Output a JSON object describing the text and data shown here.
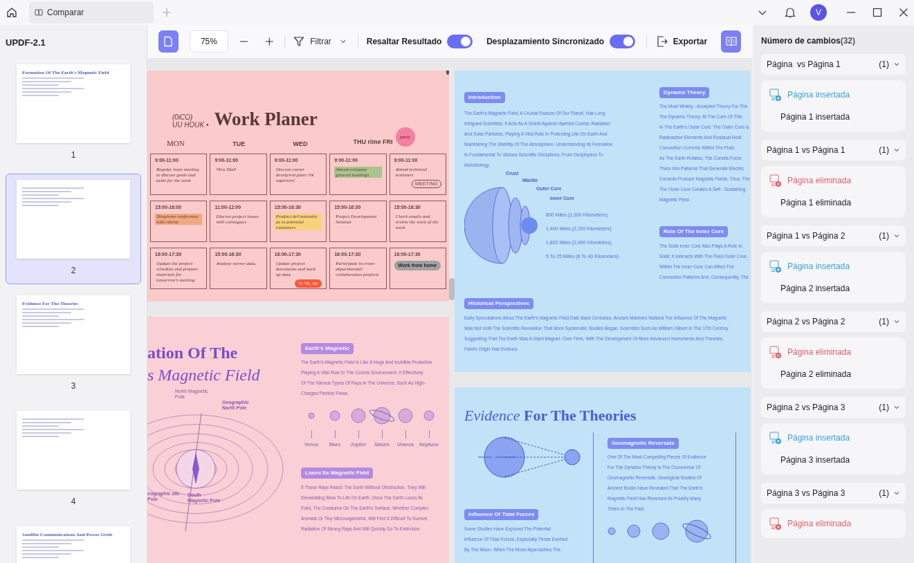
{
  "window": {
    "tab": "Comparar",
    "avatar": "V"
  },
  "sidebar": {
    "title": "UPDF-2.1",
    "thumbnails": [
      {
        "label": "1",
        "selected": false,
        "heading": "Formation Of The Earth's Magnetic Field"
      },
      {
        "label": "2",
        "selected": true
      },
      {
        "label": "3",
        "selected": false,
        "heading": "Evidence For The Theories"
      },
      {
        "label": "4",
        "selected": false
      },
      {
        "selected": false,
        "heading": "Satellite Communications And Power Grids"
      }
    ]
  },
  "toolbar": {
    "zoom": "75%",
    "filter": "Filtrar",
    "toggles": [
      {
        "label": "Resaltar Resultado",
        "on": true
      },
      {
        "label": "Desplazamiento Sincronizado",
        "on": true
      }
    ],
    "export": "Exportar"
  },
  "planner": {
    "scribble": [
      "(0iCO)",
      "UU HOUK •"
    ],
    "title": "Work Planer",
    "days": [
      "MON",
      "TUE",
      "WED",
      "THU rime FRI"
    ],
    "sticker": "party",
    "cells": [
      {
        "time": "9:00-11:00",
        "note": "Regular team meeting to discuss goals and tasks for the week"
      },
      {
        "time": "9:00-11:00",
        "note": "View Mail"
      },
      {
        "time": "9:00-11:00",
        "note": "Discuss career develp'ent plare i'tk superiors'"
      },
      {
        "time": "9:00-11:00",
        "note": "Attend company general meetings",
        "color": "#a9c48f"
      },
      {
        "time": "9:00-11:00",
        "note": "Attend technical seminars",
        "sticker": {
          "kind": "stamp",
          "text": "MEETING"
        }
      },
      {
        "time": "15:00-16:00",
        "note": "Telephone conference with clients",
        "color": "#f2a77e"
      },
      {
        "time": "11:00-12:00",
        "note": "Discuss project issues with colleagues"
      },
      {
        "time": "15:00-16:30",
        "note": "Product del'onstratio as to potential customers",
        "color": "#f7d27a"
      },
      {
        "time": "15:00-16:30",
        "note": "Project Development Seminar"
      },
      {
        "time": "15:00-16:30",
        "note": "Check emails and review the work of the week"
      },
      {
        "time": "16:00-17:30",
        "note": "Update the project schedule and prepare materials for tomorrow's meeting"
      },
      {
        "time": "15:00-16:30",
        "note": "Analyze survey data."
      },
      {
        "time": "16:00-17:30",
        "note": "Update project documents and back up data",
        "sticker": {
          "kind": "blob",
          "text": "'n ^m, ce"
        }
      },
      {
        "time": "16:00-17:30",
        "note": "Participate in cross-departmental/ collaboration projects"
      },
      {
        "time": "16:00-17:30",
        "sticker": {
          "kind": "pill",
          "text": "Work from home"
        }
      }
    ]
  },
  "formation": {
    "title": [
      "ation Of The",
      "s Magnetic Field"
    ],
    "poles": [
      "North Magnetic Pole",
      "Geographic North Pole",
      "eographic uth Pole",
      "South Magnetic Pole"
    ],
    "sections": [
      {
        "heading": "Earth's Magnetic",
        "lines": [
          "The Earth's Magnetic Field Is Like A Huge And Invisible Protective",
          "Playing A Vital Role In The Cosmic Environment. It Effectively",
          "Of The Various Types Of Rays In The Universe, Such As High-",
          "Charged Particle Flows."
        ]
      },
      {
        "heading": "Loses Its Magnetic Field",
        "lines": [
          "If These Rays Reach The Earth Without Obstruction, They Will",
          "Devastating Blow To Life On Earth. Once The Earth Loses Its",
          "Field, The Creatures On The Earth's Surface, Whether Complex",
          "Animals Or Tiny Microorganisms, Will Find It Difficult To Survive",
          "Radiation Of Strong Rays And Will Quickly Go To Extinction."
        ]
      }
    ],
    "planets": [
      "Venus",
      "Mars",
      "Jupiter",
      "Saturn",
      "Uranus",
      "Neptune"
    ]
  },
  "introduction": {
    "intro": {
      "heading": "Introduction",
      "lines": [
        "The Earth's Magnetic Field, A Crucial Feature Of Our Planet, Has Long",
        "Intrigued Scientists. It Acts As A Shield Against Harmful Cosmic Radiation",
        "And Solar Particles, Playing A Vital Role In Protecting Life On Earth And",
        "Maintaining The Stability Of The Atmosphere. Understanding Its Formation",
        "Is Fundamental To Various Scientific Disciplines, From Geophysics To",
        "Astrobiology."
      ]
    },
    "layers": [
      "Crust",
      "Mantle",
      "Outer Core",
      "Inner Core"
    ],
    "depths": [
      "800 Miles (1,300 Kilometers)",
      "1,400 Miles (2,250 Kilometers)",
      "1,800 Miles (2,900 Kilometers)",
      "5 To 25 Miles (8 To 40 Kilometers)"
    ],
    "side": [
      {
        "heading": "Dynamo Theory",
        "lines": [
          "The Most Widely - Accepted Theory For The",
          "The Dynamo Theory. At The Core Of This",
          "In The Earth's Outer Core. The Outer Core Is",
          "Radioactive Elements And Residual Heat",
          "Convection Currents Within The Fluid.",
          "As The Earth Rotates, The Coriolis Force",
          "Them Into Patterns That Generate Electric",
          "Currents Produce Magnetic Fields. Thus, The",
          "The Outer Core Creates A Self - Sustaining",
          "Magnetic Field."
        ]
      },
      {
        "heading": "Role Of The Inner Core",
        "lines": [
          "The Solid Inner Core Also Plays A Role In",
          "Solid, It Interacts With The Fluid Outer Core.",
          "Within The Inner Core Can Affect The",
          "Convective Patterns And, Consequently, The"
        ]
      }
    ],
    "history": {
      "heading": "Historical Perspectives",
      "lines": [
        "Early Speculations About The Earth's Magnetic Field Date Back Centuries. Ancient Mariners Noticed The Influence Of The Magnetic",
        "Was Not Until The Scientific Revolution That More Systematic Studies Began. Scientists Such As William Gilbert In The 17th Century",
        "Suggesting That The Earth Was A Giant Magnet. Over Time, With The Development Of More Advanced Instruments And Theories,",
        "Field's Origin Has Evolved."
      ]
    }
  },
  "evidence": {
    "title": "*Evidence* For The Theories",
    "tidal": {
      "heading": "Influence Of Tidal Forces",
      "lines": [
        "Some Studies Have Explored The Potential",
        "Influence Of Tidal Forces, Especially Those Exerted",
        "By The Moon. When The Moon Approaches The"
      ]
    },
    "reversals": {
      "heading": "Geomagnetic Reversals",
      "lines": [
        "One Of The Most Compelling Pieces Of Evidence",
        "For The Dynamo Theory Is The Occurrence Of",
        "Geomagnetic Reversals. Geological Studies Of",
        "Ancient Rocks Have Revealed That The Earth's",
        "Magnetic Field Has Reversed Its Polarity Many",
        "Times In The Past."
      ]
    }
  },
  "changes": {
    "title": "Número de cambios",
    "count": "(32)",
    "groups": [
      {
        "header": "Página  vs Página 1",
        "count": "(1)",
        "kind": "inserted",
        "label": "Página insertada",
        "detail": "Página 1 insertada"
      },
      {
        "header": "Página 1 vs Página 1",
        "count": "(1)",
        "kind": "deleted",
        "label": "Página eliminada",
        "detail": "Página 1 eliminada"
      },
      {
        "header": "Página 1 vs Página 2",
        "count": "(1)",
        "kind": "inserted",
        "label": "Página insertada",
        "detail": "Página 2 insertada"
      },
      {
        "header": "Página 2 vs Página 2",
        "count": "(1)",
        "kind": "deleted",
        "label": "Página eliminada",
        "detail": "Página 2 eliminada"
      },
      {
        "header": "Página 2 vs Página 3",
        "count": "(1)",
        "kind": "inserted",
        "label": "Página insertada",
        "detail": "Página 3 insertada"
      },
      {
        "header": "Página 3 vs Página 3",
        "count": "(1)",
        "kind": "deleted",
        "label": "Página eliminada"
      }
    ]
  }
}
